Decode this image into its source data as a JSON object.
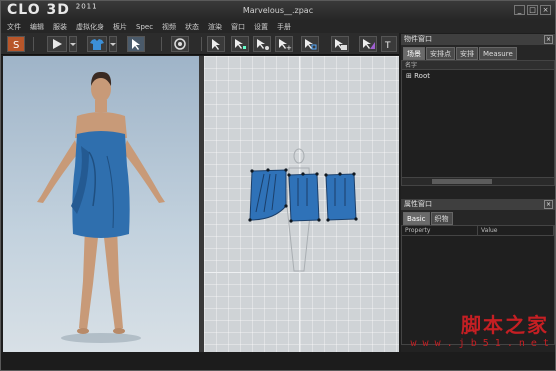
{
  "app": {
    "logo": "CLO",
    "logo_3d": "3D",
    "logo_year": "2011",
    "window_title": "Marvelous__.zpac"
  },
  "window_buttons": [
    "_",
    "□",
    "×"
  ],
  "menu": [
    "文件",
    "编辑",
    "服装",
    "虚拟化身",
    "板片",
    "Spec",
    "视频",
    "状态",
    "渲染",
    "窗口",
    "设置",
    "手册"
  ],
  "toolbar": {
    "icons": [
      "simulation-icon",
      "play-icon",
      "tshirt-icon",
      "select-icon",
      "camera-icon",
      "pointer-icon",
      "edit-point-icon",
      "curve-point-icon",
      "add-point-icon",
      "transform-icon",
      "seam-icon",
      "fold-icon",
      "text-icon"
    ]
  },
  "panels": {
    "object_browser": {
      "title": "物件窗口",
      "tabs": [
        "场景",
        "安排点",
        "安排",
        "Measure"
      ],
      "active_tab": 0,
      "column_header": "名字",
      "tree_root": "Root",
      "tree_expander": "⊞"
    },
    "property_editor": {
      "title": "属性窗口",
      "tabs": [
        "Basic",
        "织物"
      ],
      "active_tab": 0,
      "columns": [
        "Property",
        "Value"
      ]
    }
  },
  "watermark": {
    "line1": "脚本之家",
    "line2": "w w w . j b 5 1 . n e t"
  },
  "colors": {
    "dress": "#2f6fae",
    "pattern_fill": "#2f72b8",
    "viewport_3d_bg": "#b5c6d4",
    "viewport_2d_bg": "#cfd3d6",
    "watermark": "#c51f23"
  }
}
